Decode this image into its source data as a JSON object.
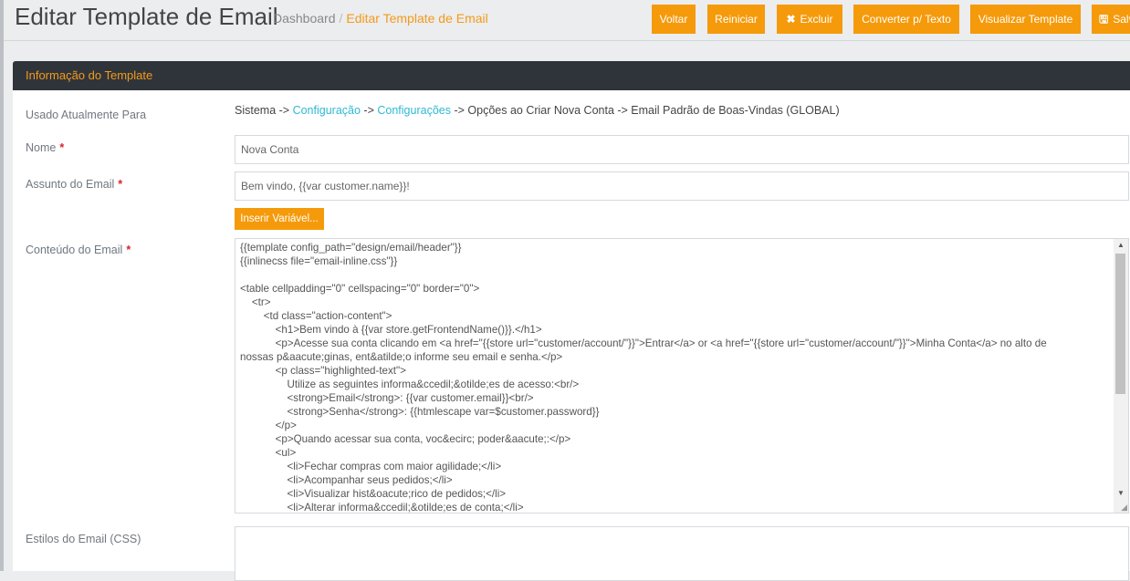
{
  "header": {
    "title": "Editar Template de Email",
    "breadcrumb": {
      "home": "Dashboard",
      "separator": "/",
      "current": "Editar Template de Email"
    },
    "buttons": {
      "back": "Voltar",
      "reset": "Reiniciar",
      "delete": "Excluir",
      "convert": "Converter p/ Texto",
      "preview": "Visualizar Template",
      "save": "Salvar Template"
    }
  },
  "panel": {
    "title": "Informação do Template"
  },
  "form": {
    "used_for": {
      "label": "Usado Atualmente Para",
      "path_prefix": "Sistema ->",
      "link1": "Configuração",
      "sep1": "->",
      "link2": "Configurações",
      "path_suffix": "-> Opções ao Criar Nova Conta -> Email Padrão de Boas-Vindas  (GLOBAL)"
    },
    "name": {
      "label": "Nome",
      "required": "*",
      "value": "Nova Conta"
    },
    "subject": {
      "label": "Assunto do Email",
      "required": "*",
      "value": "Bem vindo, {{var customer.name}}!"
    },
    "insert_variable": "Inserir Variável...",
    "content": {
      "label": "Conteúdo do Email",
      "required": "*",
      "lines": [
        "{{template config_path=\"design/email/header\"}}",
        "{{inlinecss file=\"email-inline.css\"}}",
        "",
        "<table cellpadding=\"0\" cellspacing=\"0\" border=\"0\">",
        "    <tr>",
        "        <td class=\"action-content\">",
        "            <h1>Bem vindo à {{var store.getFrontendName()}}.</h1>",
        "            <p>Acesse sua conta clicando em <a href=\"{{store url=\"customer/account/\"}}\">Entrar</a> or <a href=\"{{store url=\"customer/account/\"}}\">Minha Conta</a> no alto de",
        "nossas p&aacute;ginas, ent&atilde;o informe seu email e senha.</p>",
        "            <p class=\"highlighted-text\">",
        "                Utilize as seguintes informa&ccedil;&otilde;es de acesso:<br/>",
        "                <strong>Email</strong>: {{var customer.email}}<br/>",
        "                <strong>Senha</strong>: {{htmlescape var=$customer.password}}",
        "            </p>",
        "            <p>Quando acessar sua conta, voc&ecirc; poder&aacute;:</p>",
        "            <ul>",
        "                <li>Fechar compras com maior agilidade;</li>",
        "                <li>Acompanhar seus pedidos;</li>",
        "                <li>Visualizar hist&oacute;rico de pedidos;</li>",
        "                <li>Alterar informa&ccedil;&otilde;es de conta;</li>"
      ]
    },
    "styles": {
      "label": "Estilos do Email (CSS)"
    }
  }
}
